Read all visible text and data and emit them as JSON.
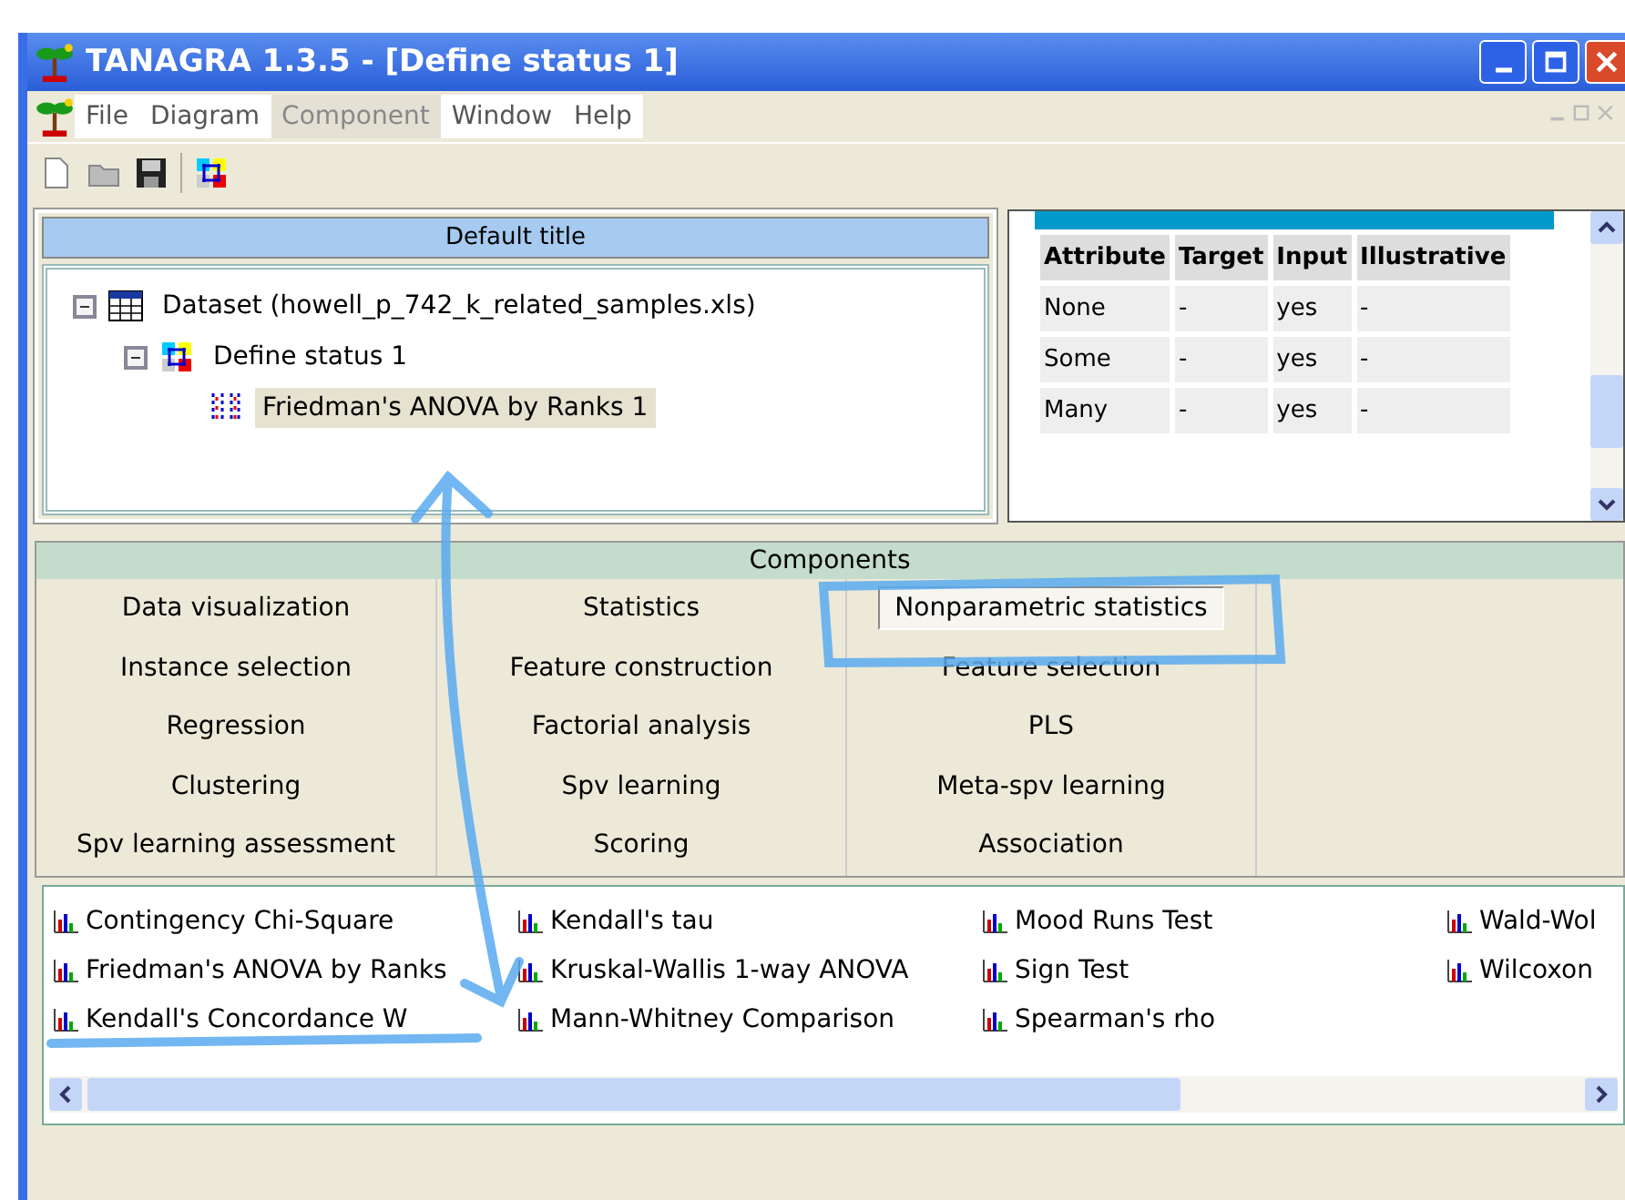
{
  "window": {
    "title": "TANAGRA 1.3.5 - [Define status 1]"
  },
  "menu": [
    {
      "label": "File",
      "selected": false
    },
    {
      "label": "Diagram",
      "selected": false
    },
    {
      "label": "Component",
      "selected": true
    },
    {
      "label": "Window",
      "selected": false
    },
    {
      "label": "Help",
      "selected": false
    }
  ],
  "diagram": {
    "title": "Default title",
    "tree": [
      {
        "label": "Dataset (howell_p_742_k_related_samples.xls)",
        "kind": "dataset",
        "expanded": true,
        "selected": false,
        "children": [
          {
            "label": "Define status 1",
            "kind": "status",
            "expanded": true,
            "selected": false,
            "children": [
              {
                "label": "Friedman's ANOVA by Ranks 1",
                "kind": "test",
                "selected": true
              }
            ]
          }
        ]
      }
    ]
  },
  "results": {
    "columns": [
      "Attribute",
      "Target",
      "Input",
      "Illustrative"
    ],
    "rows": [
      [
        "None",
        "-",
        "yes",
        "-"
      ],
      [
        "Some",
        "-",
        "yes",
        "-"
      ],
      [
        "Many",
        "-",
        "yes",
        "-"
      ]
    ]
  },
  "components": {
    "title": "Components",
    "categories": [
      {
        "label": "Data visualization",
        "selected": false
      },
      {
        "label": "Statistics",
        "selected": false
      },
      {
        "label": "Nonparametric statistics",
        "selected": true
      },
      {
        "label": "Instance selection",
        "selected": false
      },
      {
        "label": "Feature construction",
        "selected": false
      },
      {
        "label": "Feature selection",
        "selected": false
      },
      {
        "label": "Regression",
        "selected": false
      },
      {
        "label": "Factorial analysis",
        "selected": false
      },
      {
        "label": "PLS",
        "selected": false
      },
      {
        "label": "Clustering",
        "selected": false
      },
      {
        "label": "Spv learning",
        "selected": false
      },
      {
        "label": "Meta-spv learning",
        "selected": false
      },
      {
        "label": "Spv learning assessment",
        "selected": false
      },
      {
        "label": "Scoring",
        "selected": false
      },
      {
        "label": "Association",
        "selected": false
      }
    ]
  },
  "palette": [
    [
      {
        "label": "Contingency Chi-Square"
      },
      {
        "label": "Friedman's ANOVA by Ranks"
      },
      {
        "label": "Kendall's Concordance W"
      }
    ],
    [
      {
        "label": "Kendall's tau"
      },
      {
        "label": "Kruskal-Wallis 1-way ANOVA"
      },
      {
        "label": "Mann-Whitney Comparison"
      }
    ],
    [
      {
        "label": "Mood Runs Test"
      },
      {
        "label": "Sign Test"
      },
      {
        "label": "Spearman's rho"
      }
    ],
    [
      {
        "label": "Wald-Wol"
      },
      {
        "label": "Wilcoxon"
      }
    ]
  ]
}
